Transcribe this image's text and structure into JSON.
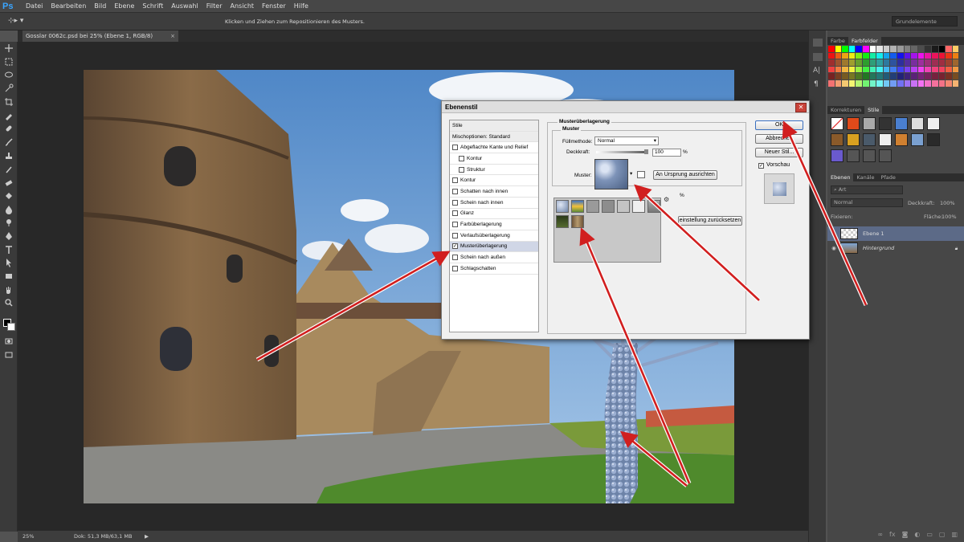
{
  "app": {
    "logo": "Ps"
  },
  "menu": [
    "Datei",
    "Bearbeiten",
    "Bild",
    "Ebene",
    "Schrift",
    "Auswahl",
    "Filter",
    "Ansicht",
    "Fenster",
    "Hilfe"
  ],
  "options_bar": {
    "hint": "Klicken und Ziehen zum Repositionieren des Musters.",
    "workspace": "Grundelemente"
  },
  "document": {
    "tab_title": "Gosslar 0062c.psd bei 25% (Ebene 1, RGB/8)",
    "tab_close": "×"
  },
  "status": {
    "zoom": "25%",
    "doc_size": "Dok: 51,3 MB/63,1 MB",
    "arrow": "▶"
  },
  "panels": {
    "color_tabs": [
      "Farbe",
      "Farbfelder"
    ],
    "adjust_tabs": [
      "Korrekturen",
      "Stile"
    ],
    "layer_tabs": [
      "Ebenen",
      "Kanäle",
      "Pfade"
    ],
    "layers": {
      "kind_filter": "Art",
      "blend_mode": "Normal",
      "opacity_label": "Deckkraft:",
      "opacity_value": "100%",
      "lock_label": "Fixieren:",
      "fill_label": "Fläche:",
      "fill_value": "100%",
      "items": [
        {
          "name": "Ebene 1",
          "active": true
        },
        {
          "name": "Hintergrund",
          "active": false
        }
      ]
    }
  },
  "dialog": {
    "title": "Ebenenstil",
    "close": "✕",
    "style_list": [
      {
        "label": "Stile",
        "type": "header"
      },
      {
        "label": "Mischoptionen: Standard",
        "type": "header"
      },
      {
        "label": "Abgeflachte Kante und Relief",
        "checked": false
      },
      {
        "label": "Kontur",
        "checked": false,
        "indent": true
      },
      {
        "label": "Struktur",
        "checked": false,
        "indent": true
      },
      {
        "label": "Kontur",
        "checked": false
      },
      {
        "label": "Schatten nach innen",
        "checked": false
      },
      {
        "label": "Schein nach innen",
        "checked": false
      },
      {
        "label": "Glanz",
        "checked": false
      },
      {
        "label": "Farbüberlagerung",
        "checked": false
      },
      {
        "label": "Verlaufsüberlagerung",
        "checked": false
      },
      {
        "label": "Musterüberlagerung",
        "checked": true,
        "selected": true
      },
      {
        "label": "Schein nach außen",
        "checked": false
      },
      {
        "label": "Schlagschatten",
        "checked": false
      }
    ],
    "section_title": "Musterüberlagerung",
    "group_title": "Muster",
    "fill_label": "Füllmethode:",
    "fill_value": "Normal",
    "opacity_label": "Deckkraft:",
    "opacity_value": "100",
    "percent": "%",
    "pattern_label": "Muster:",
    "snap_button": "An Ursprung ausrichten",
    "reset_button": "einstellung zurücksetzen",
    "buttons": {
      "ok": "OK",
      "cancel": "Abbrechen",
      "new_style": "Neuer Stil...",
      "preview": "Vorschau"
    },
    "preview_checked": true
  }
}
